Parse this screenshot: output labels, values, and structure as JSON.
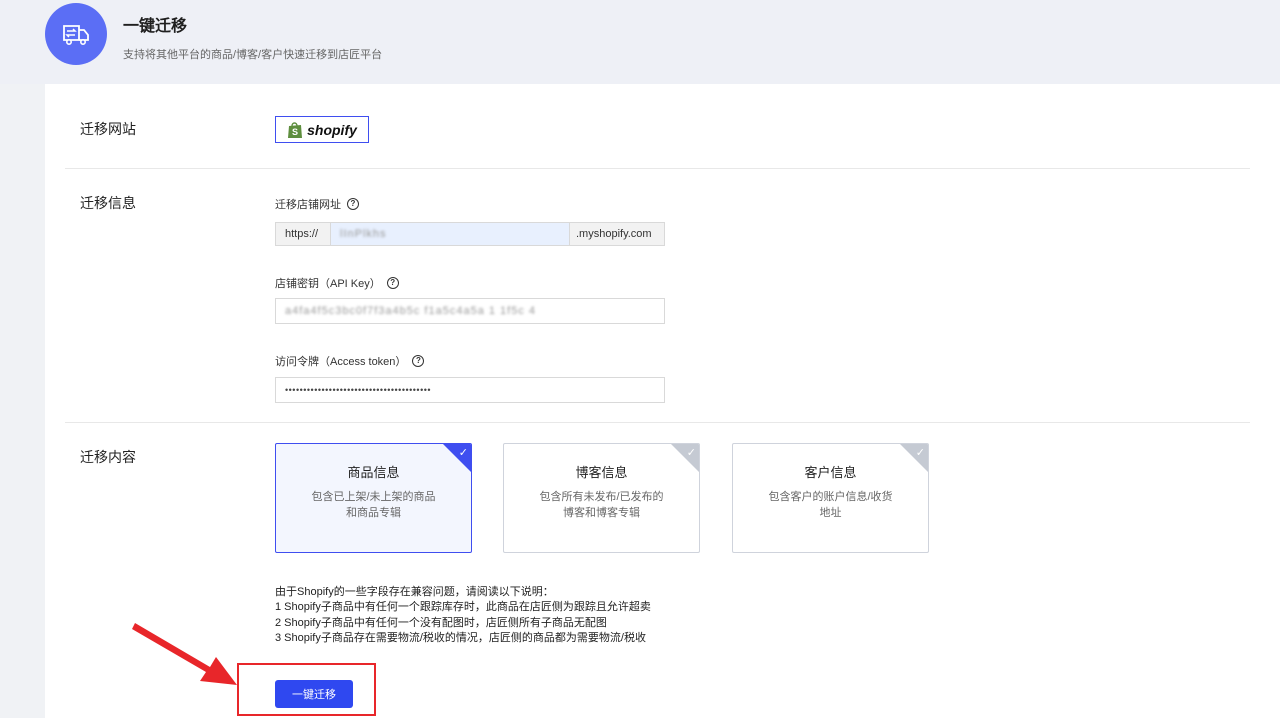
{
  "header": {
    "title": "一键迁移",
    "subtitle": "支持将其他平台的商品/博客/客户快速迁移到店匠平台",
    "icon": "truck-migrate-icon"
  },
  "site": {
    "label": "迁移网站",
    "platform": "shopify"
  },
  "info": {
    "label": "迁移信息",
    "store_url_label": "迁移店铺网址",
    "store_url_prefix": "https://",
    "store_url_value": "lInPlkhs",
    "store_url_suffix": ".myshopify.com",
    "api_key_label": "店铺密钥（API Key）",
    "api_key_value": "a4fa4f5c3bc0f7f3a4b5c f1a5c4a5a 1 1f5c 4",
    "token_label": "访问令牌（Access token）",
    "token_value": "••••••••••••••••••••••••••••••••••••••••"
  },
  "content": {
    "label": "迁移内容",
    "cards": [
      {
        "title": "商品信息",
        "desc_line1": "包含已上架/未上架的商品",
        "desc_line2": "和商品专辑",
        "selected": true
      },
      {
        "title": "博客信息",
        "desc_line1": "包含所有未发布/已发布的",
        "desc_line2": "博客和博客专辑",
        "selected": false
      },
      {
        "title": "客户信息",
        "desc_line1": "包含客户的账户信息/收货",
        "desc_line2": "地址",
        "selected": false
      }
    ]
  },
  "notice": {
    "line0": "由于Shopify的一些字段存在兼容问题，请阅读以下说明：",
    "line1": "1 Shopify子商品中有任何一个跟踪库存时，此商品在店匠侧为跟踪且允许超卖",
    "line2": "2 Shopify子商品中有任何一个没有配图时，店匠侧所有子商品无配图",
    "line3": "3 Shopify子商品存在需要物流/税收的情况，店匠侧的商品都为需要物流/税收"
  },
  "actions": {
    "migrate_label": "一键迁移"
  },
  "colors": {
    "accent": "#2f48f0",
    "header_icon_bg": "#5b6ef5",
    "annotation_red": "#e8262a"
  }
}
